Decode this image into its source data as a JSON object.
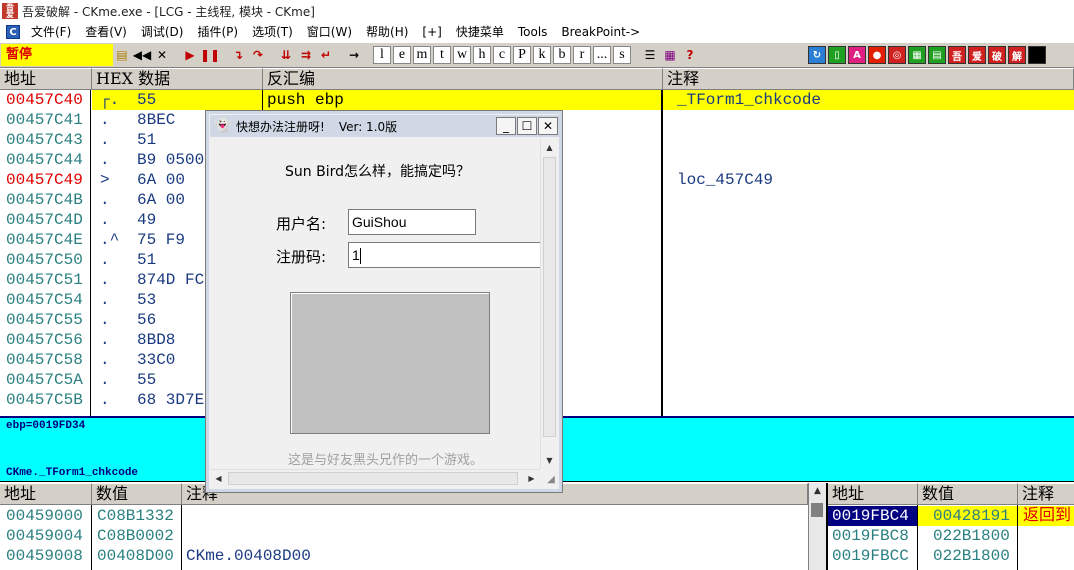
{
  "window": {
    "title": "吾爱破解 - CKme.exe - [LCG - 主线程, 模块 - CKme]"
  },
  "menu": {
    "items": [
      "文件(F)",
      "查看(V)",
      "调试(D)",
      "插件(P)",
      "选项(T)",
      "窗口(W)",
      "帮助(H)",
      "[+]",
      "快捷菜单",
      "Tools",
      "BreakPoint->"
    ]
  },
  "toolbar": {
    "status": "暂停",
    "letters": [
      "l",
      "e",
      "m",
      "t",
      "w",
      "h",
      "c",
      "P",
      "k",
      "b",
      "r",
      "...",
      "s"
    ],
    "right_buttons": [
      "吾",
      "爱",
      "破",
      "解"
    ]
  },
  "cpu": {
    "headers": {
      "address": "地址",
      "hex": "HEX 数据",
      "disasm": "反汇编",
      "comment": "注释"
    },
    "rows": [
      {
        "addr": "00457C40",
        "mark": "┌.",
        "hex": "55",
        "asm": "push ebp",
        "comment": "_TForm1_chkcode",
        "addr_red": true,
        "highlight": true
      },
      {
        "addr": "00457C41",
        "mark": ".",
        "hex": "8BEC",
        "asm": "",
        "comment": ""
      },
      {
        "addr": "00457C43",
        "mark": ".",
        "hex": "51",
        "asm": "",
        "comment": ""
      },
      {
        "addr": "00457C44",
        "mark": ".",
        "hex": "B9 0500",
        "asm": "",
        "comment": ""
      },
      {
        "addr": "00457C49",
        "mark": ">",
        "hex": "6A 00",
        "asm": "",
        "comment": "loc_457C49",
        "addr_red": true
      },
      {
        "addr": "00457C4B",
        "mark": ".",
        "hex": "6A 00",
        "asm": "",
        "comment": ""
      },
      {
        "addr": "00457C4D",
        "mark": ".",
        "hex": "49",
        "asm": "",
        "comment": ""
      },
      {
        "addr": "00457C4E",
        "mark": ".^",
        "hex": "75 F9",
        "asm": "",
        "comment": ""
      },
      {
        "addr": "00457C50",
        "mark": ".",
        "hex": "51",
        "asm": "",
        "comment": ""
      },
      {
        "addr": "00457C51",
        "mark": ".",
        "hex": "874D FC",
        "asm": "",
        "comment": ""
      },
      {
        "addr": "00457C54",
        "mark": ".",
        "hex": "53",
        "asm": "",
        "comment": ""
      },
      {
        "addr": "00457C55",
        "mark": ".",
        "hex": "56",
        "asm": "",
        "comment": ""
      },
      {
        "addr": "00457C56",
        "mark": ".",
        "hex": "8BD8",
        "asm": "",
        "comment": ""
      },
      {
        "addr": "00457C58",
        "mark": ".",
        "hex": "33C0",
        "asm": "",
        "comment": ""
      },
      {
        "addr": "00457C5A",
        "mark": ".",
        "hex": "55",
        "asm": "",
        "comment": ""
      },
      {
        "addr": "00457C5B",
        "mark": ".",
        "hex": "68 3D7E",
        "asm": "",
        "comment": ""
      }
    ]
  },
  "info": {
    "line1": "ebp=0019FD34",
    "line2": "CKme._TForm1_chkcode"
  },
  "dump": {
    "headers": {
      "address": "地址",
      "value": "数值",
      "comment": "注释"
    },
    "rows": [
      {
        "addr": "00459000",
        "value": "C08B1332",
        "comment": ""
      },
      {
        "addr": "00459004",
        "value": "C08B0002",
        "comment": ""
      },
      {
        "addr": "00459008",
        "value": "00408D00",
        "comment": "CKme.00408D00"
      }
    ]
  },
  "stack": {
    "headers": {
      "address": "地址",
      "value": "数值",
      "comment": "注释"
    },
    "rows": [
      {
        "addr": "0019FBC4",
        "value": "00428191",
        "comment": "返回到",
        "selected": true
      },
      {
        "addr": "0019FBC8",
        "value": "022B1800",
        "comment": ""
      },
      {
        "addr": "0019FBCC",
        "value": "022B1800",
        "comment": ""
      }
    ]
  },
  "dialog": {
    "title": "快想办法注册呀!",
    "version": "Ver: 1.0版",
    "question": "Sun Bird怎么样，能搞定吗？",
    "username_label": "用户名:",
    "username_value": "GuiShou",
    "regcode_label": "注册码:",
    "regcode_value": "1",
    "footer": "这是与好友黑头兄作的一个游戏。"
  }
}
